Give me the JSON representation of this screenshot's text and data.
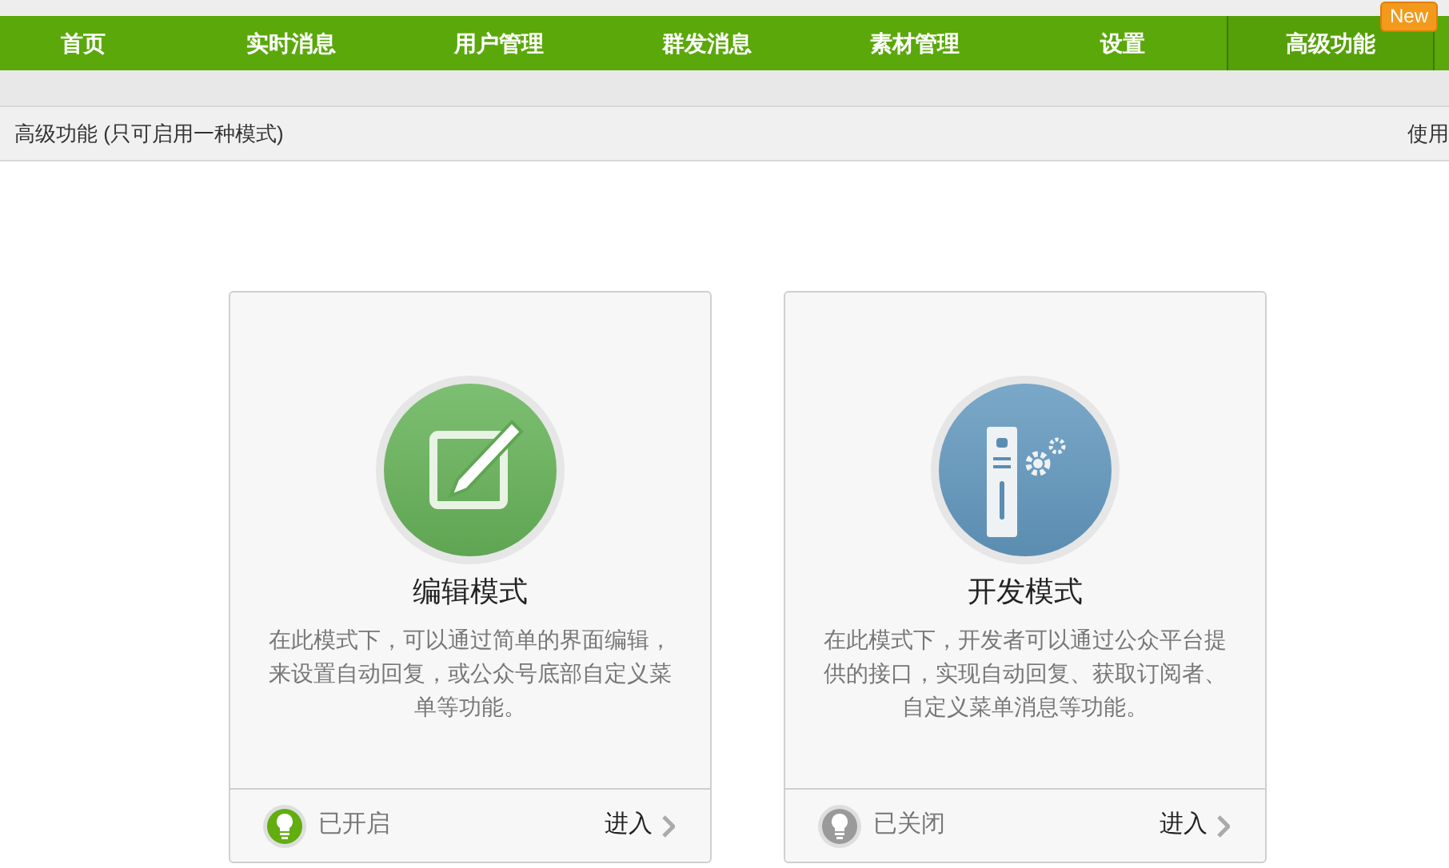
{
  "nav": {
    "items": [
      {
        "label": "首页",
        "selected": false
      },
      {
        "label": "实时消息",
        "selected": false
      },
      {
        "label": "用户管理",
        "selected": false
      },
      {
        "label": "群发消息",
        "selected": false
      },
      {
        "label": "素材管理",
        "selected": false
      },
      {
        "label": "设置",
        "selected": false
      },
      {
        "label": "高级功能",
        "selected": true,
        "badge": "New"
      }
    ]
  },
  "header": {
    "title": "高级功能 (只可启用一种模式)",
    "link": "使用"
  },
  "cards": [
    {
      "kind": "edit",
      "title": "编辑模式",
      "description": "在此模式下，可以通过简单的界面编辑，来设置自动回复，或公众号底部自定义菜单等功能。",
      "on": true,
      "status": "已开启",
      "action": "进入"
    },
    {
      "kind": "develop",
      "title": "开发模式",
      "description": "在此模式下，开发者可以通过公众平台提供的接口，实现自动回复、获取订阅者、自定义菜单消息等功能。",
      "on": false,
      "status": "已关闭",
      "action": "进入"
    }
  ]
}
